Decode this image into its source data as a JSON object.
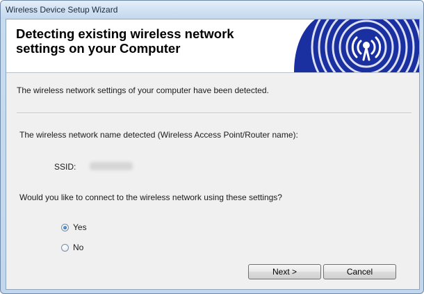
{
  "window": {
    "title": "Wireless Device Setup Wizard"
  },
  "header": {
    "title": "Detecting existing wireless network settings on your Computer",
    "banner_icon": "wireless-antenna-icon",
    "banner_color": "#1a2fa0"
  },
  "content": {
    "detected_message": "The wireless network settings of your computer have been detected.",
    "network_name_label": "The wireless network name detected (Wireless Access Point/Router name):",
    "ssid_label": "SSID:",
    "question": "Would you like to connect to the wireless network using these settings?"
  },
  "options": [
    {
      "label": "Yes",
      "selected": true
    },
    {
      "label": "No",
      "selected": false
    }
  ],
  "buttons": {
    "next": "Next >",
    "cancel": "Cancel"
  }
}
